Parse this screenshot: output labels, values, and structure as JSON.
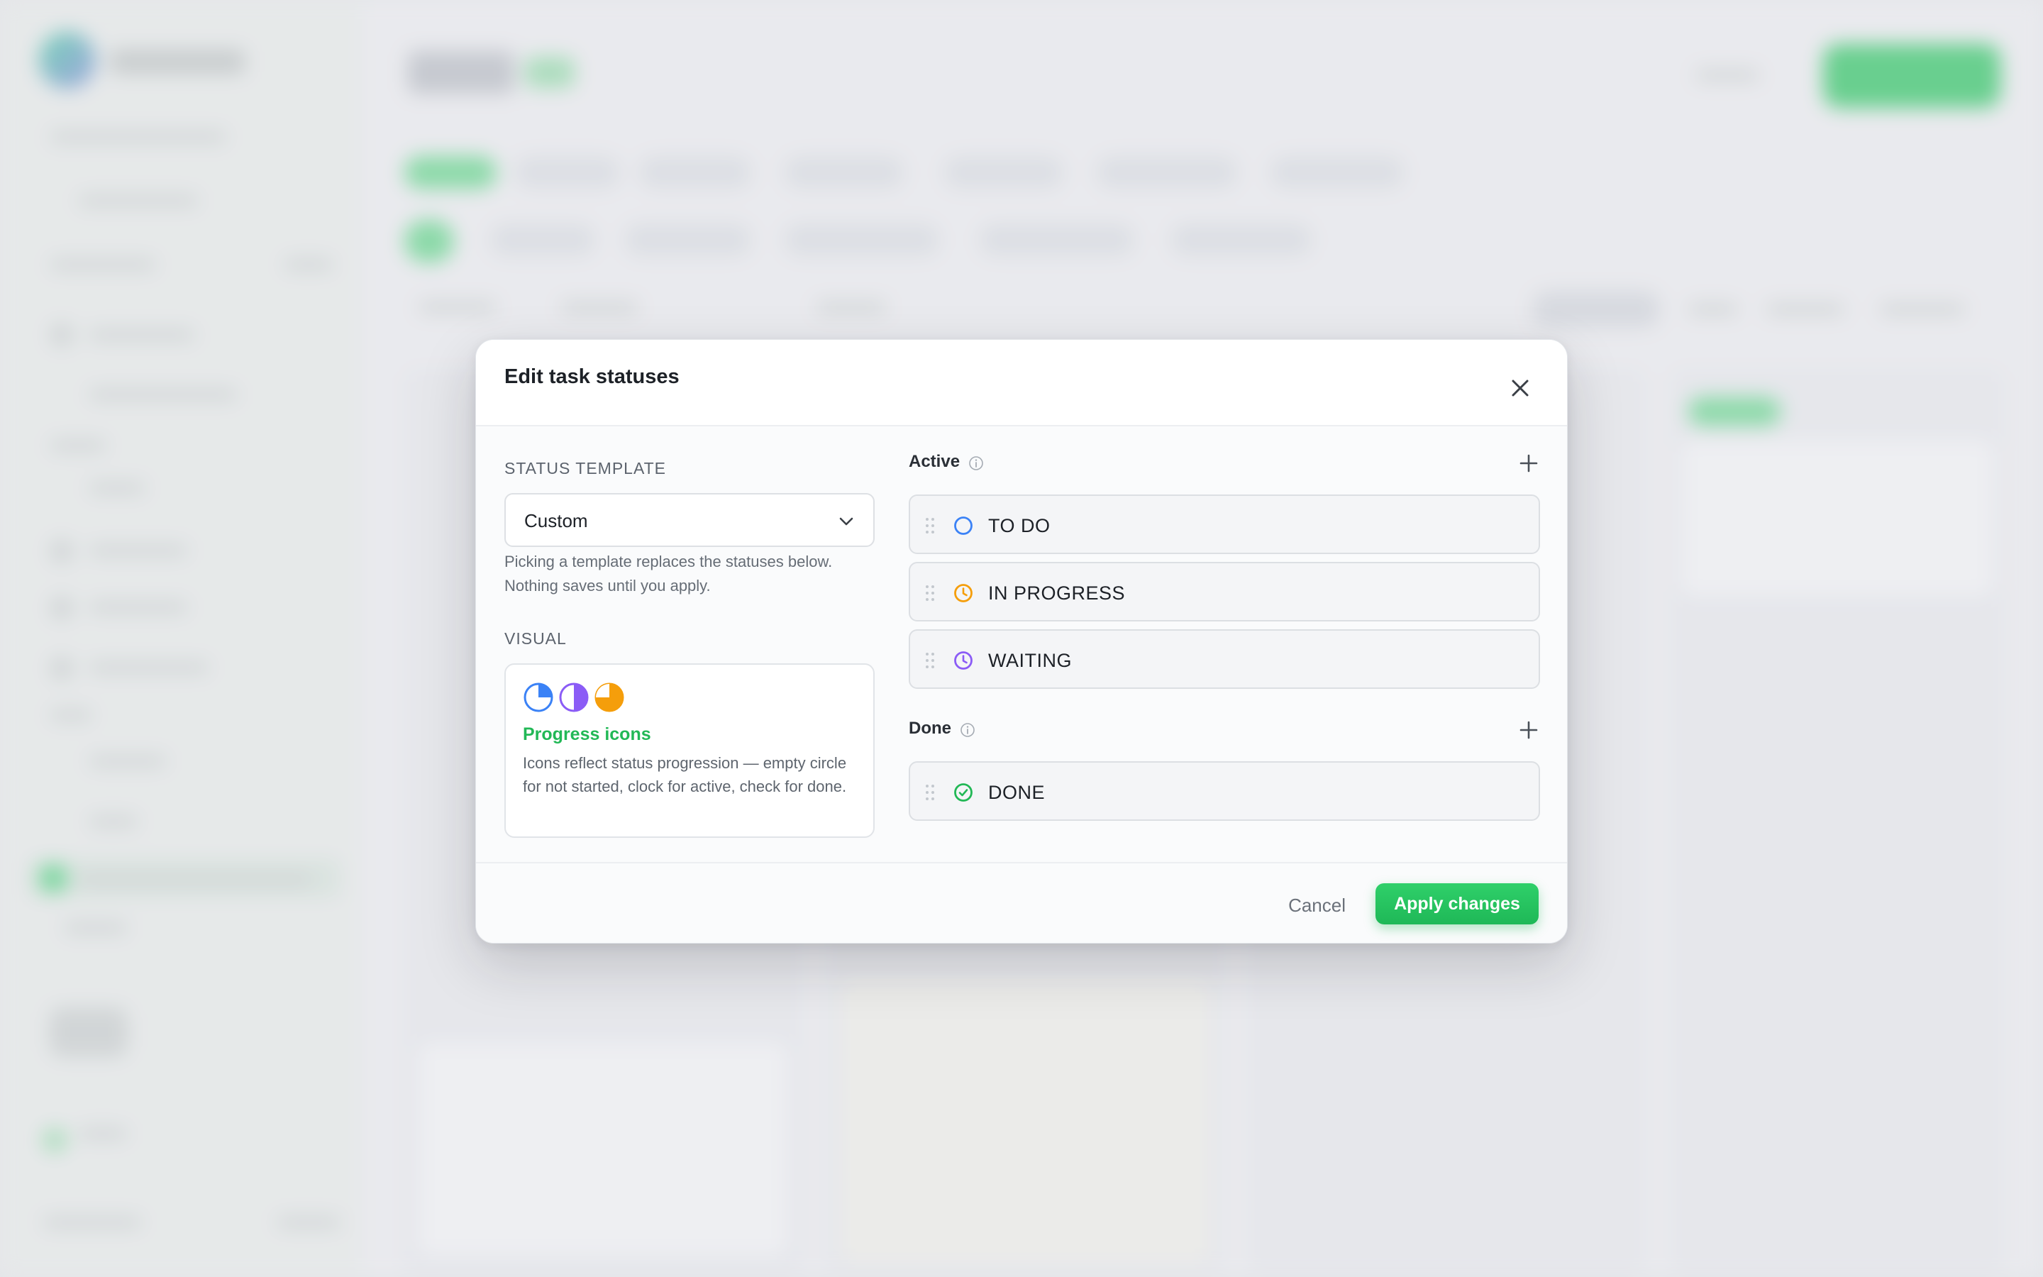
{
  "modal": {
    "title": "Edit task statuses"
  },
  "template": {
    "label": "STATUS TEMPLATE",
    "selected": "Custom",
    "helper": "Picking a template replaces the statuses below. Nothing saves until you apply."
  },
  "visual": {
    "label": "VISUAL",
    "name": "Progress icons",
    "description": "Icons reflect status progression — empty circle for not started, clock for active, check for done.",
    "icons": [
      "quarter-pie-blue-icon",
      "half-pie-purple-icon",
      "three-quarter-pie-orange-icon"
    ]
  },
  "groups": {
    "active": {
      "title": "Active",
      "statuses": [
        {
          "label": "TO DO",
          "icon": "empty-circle-icon",
          "color": "#3b82f6"
        },
        {
          "label": "IN PROGRESS",
          "icon": "clock-icon",
          "color": "#f59e0b"
        },
        {
          "label": "WAITING",
          "icon": "clock-icon",
          "color": "#8b5cf6"
        }
      ]
    },
    "done": {
      "title": "Done",
      "statuses": [
        {
          "label": "DONE",
          "icon": "check-circle-icon",
          "color": "#22b856"
        }
      ]
    }
  },
  "footer": {
    "cancel": "Cancel",
    "apply": "Apply changes"
  },
  "colors": {
    "accent": "#22b856",
    "blue": "#3b82f6",
    "purple": "#8b5cf6",
    "orange": "#f59e0b"
  }
}
